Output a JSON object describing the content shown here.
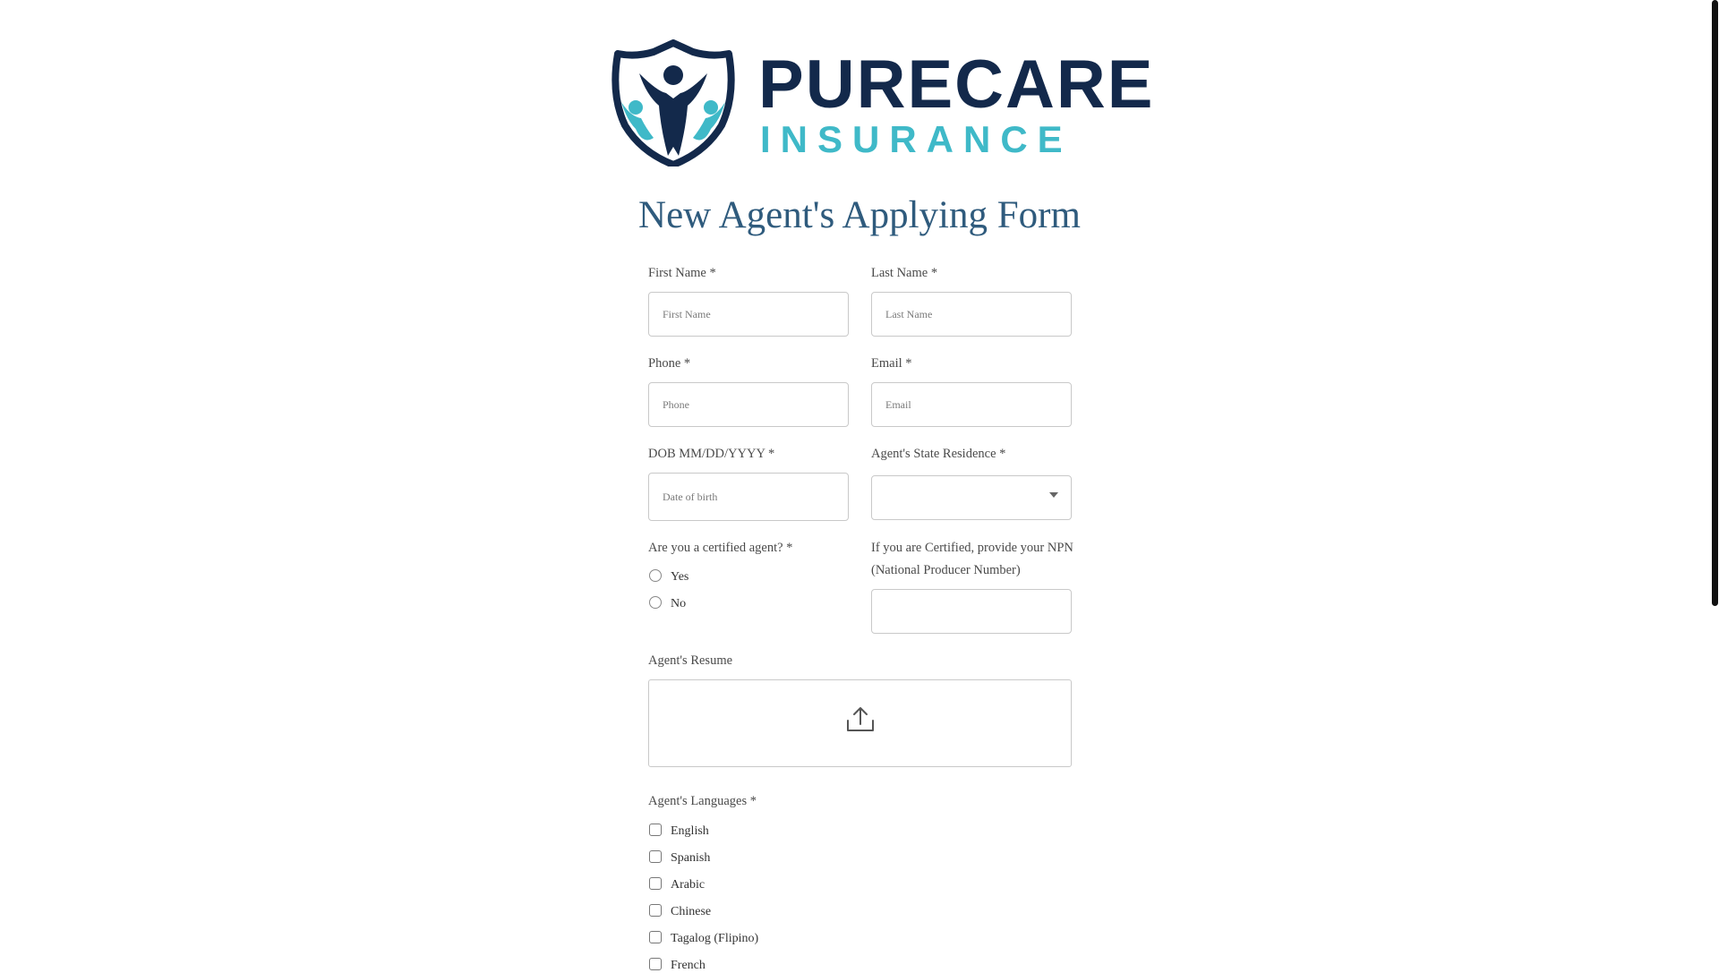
{
  "brand": {
    "name": "PURECARE",
    "sub": "INSURANCE",
    "primary_color": "#13294b",
    "accent_color": "#3fb9c8"
  },
  "form": {
    "title": "New Agent's Applying Form",
    "first_name": {
      "label": "First Name *",
      "placeholder": "First Name"
    },
    "last_name": {
      "label": "Last Name *",
      "placeholder": "Last Name"
    },
    "phone": {
      "label": "Phone *",
      "placeholder": "Phone"
    },
    "email": {
      "label": "Email *",
      "placeholder": "Email"
    },
    "dob": {
      "label": "DOB MM/DD/YYYY *",
      "placeholder": "Date of birth"
    },
    "state": {
      "label": "Agent's State Residence *",
      "value": ""
    },
    "certified": {
      "label": "Are you a certified agent? *",
      "options": [
        "Yes",
        "No"
      ]
    },
    "npn": {
      "label_line1": "If you are Certified, provide your NPN",
      "label_line2": "(National Producer Number)",
      "value": ""
    },
    "resume": {
      "label": "Agent's Resume",
      "icon": "upload-icon"
    },
    "languages": {
      "label": "Agent's Languages *",
      "options": [
        "English",
        "Spanish",
        "Arabic",
        "Chinese",
        "Tagalog (Flipino)",
        "French"
      ]
    }
  }
}
